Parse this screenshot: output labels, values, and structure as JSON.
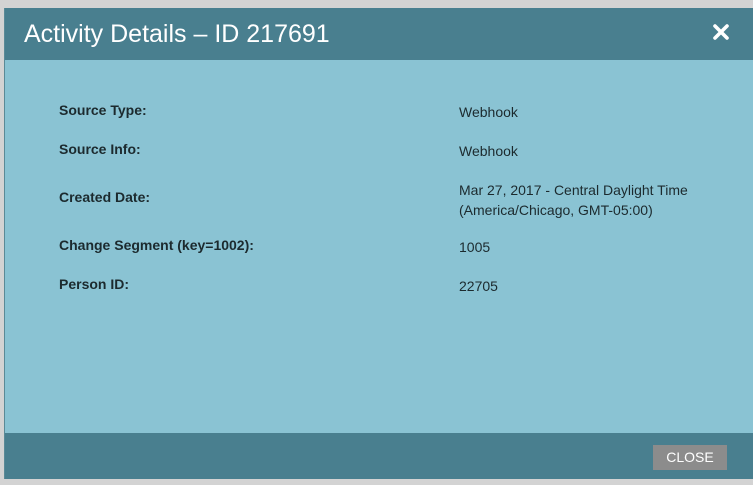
{
  "dialog": {
    "title": "Activity Details – ID 217691",
    "close_icon": "close-icon",
    "details": [
      {
        "label": "Source Type:",
        "value": [
          "Webhook"
        ]
      },
      {
        "label": "Source Info:",
        "value": [
          "Webhook"
        ]
      },
      {
        "label": "Created Date:",
        "value": [
          "Mar 27, 2017 - Central Daylight Time",
          "(America/Chicago, GMT-05:00)"
        ]
      },
      {
        "label": "Change Segment (key=1002):",
        "value": [
          "1005"
        ]
      },
      {
        "label": "Person ID:",
        "value": [
          "22705"
        ]
      }
    ],
    "close_button_label": "CLOSE"
  },
  "colors": {
    "header": "#497f8f",
    "body": "#8ac3d3",
    "button": "#8c8c8c"
  }
}
